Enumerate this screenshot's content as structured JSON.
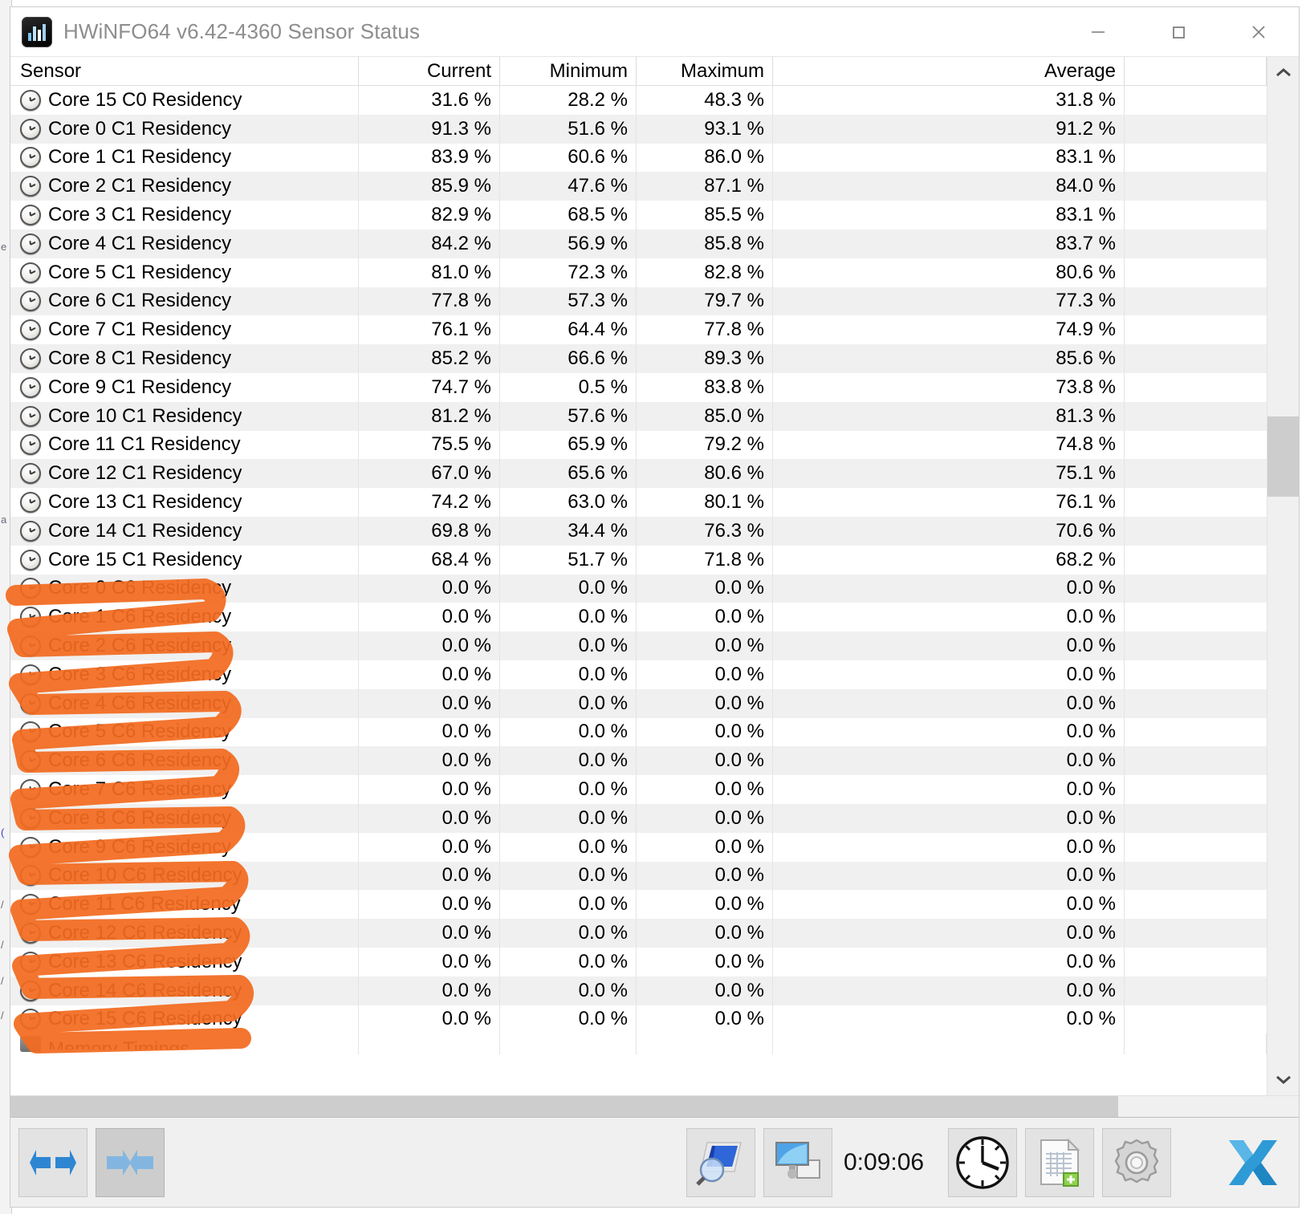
{
  "window": {
    "title": "HWiNFO64 v6.42-4360 Sensor Status",
    "icon": "hwinfo-logo-icon",
    "controls": {
      "minimize": "minimize-icon",
      "maximize": "maximize-icon",
      "close": "close-icon"
    }
  },
  "colors": {
    "highlighter": "#F26B1F",
    "row_alt": "#F0F0F0",
    "toolbar_bg": "#F0F0F0",
    "title_text": "#8D8D8D"
  },
  "table": {
    "columns": [
      "Sensor",
      "Current",
      "Minimum",
      "Maximum",
      "",
      "Average"
    ],
    "rows": [
      {
        "sensor": "Core 15 C0 Residency",
        "current": "31.6 %",
        "minimum": "28.2 %",
        "maximum": "48.3 %",
        "average": "31.8 %",
        "highlighted": false
      },
      {
        "sensor": "Core 0 C1 Residency",
        "current": "91.3 %",
        "minimum": "51.6 %",
        "maximum": "93.1 %",
        "average": "91.2 %",
        "highlighted": false
      },
      {
        "sensor": "Core 1 C1 Residency",
        "current": "83.9 %",
        "minimum": "60.6 %",
        "maximum": "86.0 %",
        "average": "83.1 %",
        "highlighted": false
      },
      {
        "sensor": "Core 2 C1 Residency",
        "current": "85.9 %",
        "minimum": "47.6 %",
        "maximum": "87.1 %",
        "average": "84.0 %",
        "highlighted": false
      },
      {
        "sensor": "Core 3 C1 Residency",
        "current": "82.9 %",
        "minimum": "68.5 %",
        "maximum": "85.5 %",
        "average": "83.1 %",
        "highlighted": false
      },
      {
        "sensor": "Core 4 C1 Residency",
        "current": "84.2 %",
        "minimum": "56.9 %",
        "maximum": "85.8 %",
        "average": "83.7 %",
        "highlighted": false
      },
      {
        "sensor": "Core 5 C1 Residency",
        "current": "81.0 %",
        "minimum": "72.3 %",
        "maximum": "82.8 %",
        "average": "80.6 %",
        "highlighted": false
      },
      {
        "sensor": "Core 6 C1 Residency",
        "current": "77.8 %",
        "minimum": "57.3 %",
        "maximum": "79.7 %",
        "average": "77.3 %",
        "highlighted": false
      },
      {
        "sensor": "Core 7 C1 Residency",
        "current": "76.1 %",
        "minimum": "64.4 %",
        "maximum": "77.8 %",
        "average": "74.9 %",
        "highlighted": false
      },
      {
        "sensor": "Core 8 C1 Residency",
        "current": "85.2 %",
        "minimum": "66.6 %",
        "maximum": "89.3 %",
        "average": "85.6 %",
        "highlighted": false
      },
      {
        "sensor": "Core 9 C1 Residency",
        "current": "74.7 %",
        "minimum": "0.5 %",
        "maximum": "83.8 %",
        "average": "73.8 %",
        "highlighted": false
      },
      {
        "sensor": "Core 10 C1 Residency",
        "current": "81.2 %",
        "minimum": "57.6 %",
        "maximum": "85.0 %",
        "average": "81.3 %",
        "highlighted": false
      },
      {
        "sensor": "Core 11 C1 Residency",
        "current": "75.5 %",
        "minimum": "65.9 %",
        "maximum": "79.2 %",
        "average": "74.8 %",
        "highlighted": false
      },
      {
        "sensor": "Core 12 C1 Residency",
        "current": "67.0 %",
        "minimum": "65.6 %",
        "maximum": "80.6 %",
        "average": "75.1 %",
        "highlighted": false
      },
      {
        "sensor": "Core 13 C1 Residency",
        "current": "74.2 %",
        "minimum": "63.0 %",
        "maximum": "80.1 %",
        "average": "76.1 %",
        "highlighted": false
      },
      {
        "sensor": "Core 14 C1 Residency",
        "current": "69.8 %",
        "minimum": "34.4 %",
        "maximum": "76.3 %",
        "average": "70.6 %",
        "highlighted": false
      },
      {
        "sensor": "Core 15 C1 Residency",
        "current": "68.4 %",
        "minimum": "51.7 %",
        "maximum": "71.8 %",
        "average": "68.2 %",
        "highlighted": false
      },
      {
        "sensor": "Core 0 C6 Residency",
        "current": "0.0 %",
        "minimum": "0.0 %",
        "maximum": "0.0 %",
        "average": "0.0 %",
        "highlighted": true
      },
      {
        "sensor": "Core 1 C6 Residency",
        "current": "0.0 %",
        "minimum": "0.0 %",
        "maximum": "0.0 %",
        "average": "0.0 %",
        "highlighted": true
      },
      {
        "sensor": "Core 2 C6 Residency",
        "current": "0.0 %",
        "minimum": "0.0 %",
        "maximum": "0.0 %",
        "average": "0.0 %",
        "highlighted": true
      },
      {
        "sensor": "Core 3 C6 Residency",
        "current": "0.0 %",
        "minimum": "0.0 %",
        "maximum": "0.0 %",
        "average": "0.0 %",
        "highlighted": true
      },
      {
        "sensor": "Core 4 C6 Residency",
        "current": "0.0 %",
        "minimum": "0.0 %",
        "maximum": "0.0 %",
        "average": "0.0 %",
        "highlighted": true
      },
      {
        "sensor": "Core 5 C6 Residency",
        "current": "0.0 %",
        "minimum": "0.0 %",
        "maximum": "0.0 %",
        "average": "0.0 %",
        "highlighted": true
      },
      {
        "sensor": "Core 6 C6 Residency",
        "current": "0.0 %",
        "minimum": "0.0 %",
        "maximum": "0.0 %",
        "average": "0.0 %",
        "highlighted": true
      },
      {
        "sensor": "Core 7 C6 Residency",
        "current": "0.0 %",
        "minimum": "0.0 %",
        "maximum": "0.0 %",
        "average": "0.0 %",
        "highlighted": true
      },
      {
        "sensor": "Core 8 C6 Residency",
        "current": "0.0 %",
        "minimum": "0.0 %",
        "maximum": "0.0 %",
        "average": "0.0 %",
        "highlighted": true
      },
      {
        "sensor": "Core 9 C6 Residency",
        "current": "0.0 %",
        "minimum": "0.0 %",
        "maximum": "0.0 %",
        "average": "0.0 %",
        "highlighted": true
      },
      {
        "sensor": "Core 10 C6 Residency",
        "current": "0.0 %",
        "minimum": "0.0 %",
        "maximum": "0.0 %",
        "average": "0.0 %",
        "highlighted": true
      },
      {
        "sensor": "Core 11 C6 Residency",
        "current": "0.0 %",
        "minimum": "0.0 %",
        "maximum": "0.0 %",
        "average": "0.0 %",
        "highlighted": true
      },
      {
        "sensor": "Core 12 C6 Residency",
        "current": "0.0 %",
        "minimum": "0.0 %",
        "maximum": "0.0 %",
        "average": "0.0 %",
        "highlighted": true
      },
      {
        "sensor": "Core 13 C6 Residency",
        "current": "0.0 %",
        "minimum": "0.0 %",
        "maximum": "0.0 %",
        "average": "0.0 %",
        "highlighted": true
      },
      {
        "sensor": "Core 14 C6 Residency",
        "current": "0.0 %",
        "minimum": "0.0 %",
        "maximum": "0.0 %",
        "average": "0.0 %",
        "highlighted": true
      },
      {
        "sensor": "Core 15 C6 Residency",
        "current": "0.0 %",
        "minimum": "0.0 %",
        "maximum": "0.0 %",
        "average": "0.0 %",
        "highlighted": true
      }
    ],
    "clipped_row": {
      "sensor": "Memory Timings"
    }
  },
  "toolbar": {
    "expand_all": "expand-arrows-icon",
    "collapse_all": "collapse-arrows-icon",
    "sensor_settings": "screen-magnifier-icon",
    "remote_monitor": "dual-monitor-icon",
    "elapsed_time": "0:09:06",
    "reset_timer": "clock-icon",
    "logging": "report-log-icon",
    "configure": "gear-icon",
    "close_app": "blue-x-icon"
  }
}
